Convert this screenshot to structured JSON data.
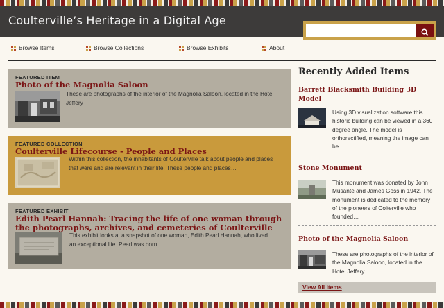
{
  "site": {
    "title": "Coulterville’s Heritage in a Digital Age"
  },
  "search": {
    "placeholder": "",
    "value": ""
  },
  "nav": {
    "items": [
      {
        "label": "Browse Items"
      },
      {
        "label": "Browse Collections"
      },
      {
        "label": "Browse Exhibits"
      },
      {
        "label": "About"
      }
    ]
  },
  "featured_item": {
    "label": "FEATURED ITEM",
    "title": "Photo of the Magnolia Saloon",
    "description": "These are photographs of the interior of the Magnolia Saloon, located in the Hotel Jeffery"
  },
  "featured_collection": {
    "label": "FEATURED COLLECTION",
    "title": "Coulterville Lifecourse - People and Places",
    "description": "Within this collection, the inhabitants of Coulterville talk about people and places that were and are relevant in their life. These people and places…"
  },
  "featured_exhibit": {
    "label": "FEATURED EXHIBIT",
    "title": "Edith Pearl Hannah: Tracing the life of one woman through the photographs, archives, and cemeteries of Coulterville",
    "description": "This exhibit looks at a snapshot of one woman, Edith Pearl Hannah, who lived an exceptional life. Pearl was born…"
  },
  "sidebar": {
    "heading": "Recently Added Items",
    "items": [
      {
        "title": "Barrett Blacksmith Building 3D Model",
        "description": "Using 3D visualization software this historic building can be viewed in a 360 degree angle. The model is orthorectified, meaning the image can be…"
      },
      {
        "title": "Stone Monument",
        "description": "This monument was donated by John Musante and James Goss in 1942. The monument is dedicated to the memory of the pioneers of Colterville who founded…"
      },
      {
        "title": "Photo of the Magnolia Saloon",
        "description": "These are photographs of the interior of the Magnolia Saloon, located in the Hotel Jeffery"
      }
    ],
    "view_all": "View All Items"
  },
  "colors": {
    "header_bg": "#3d3b3a",
    "accent_gold": "#c9a24a",
    "accent_red": "#7a1515",
    "panel_gray": "#b3ada0",
    "panel_gold": "#c99a3c"
  },
  "icons": [
    "search-icon",
    "nav-bullet-icon"
  ]
}
